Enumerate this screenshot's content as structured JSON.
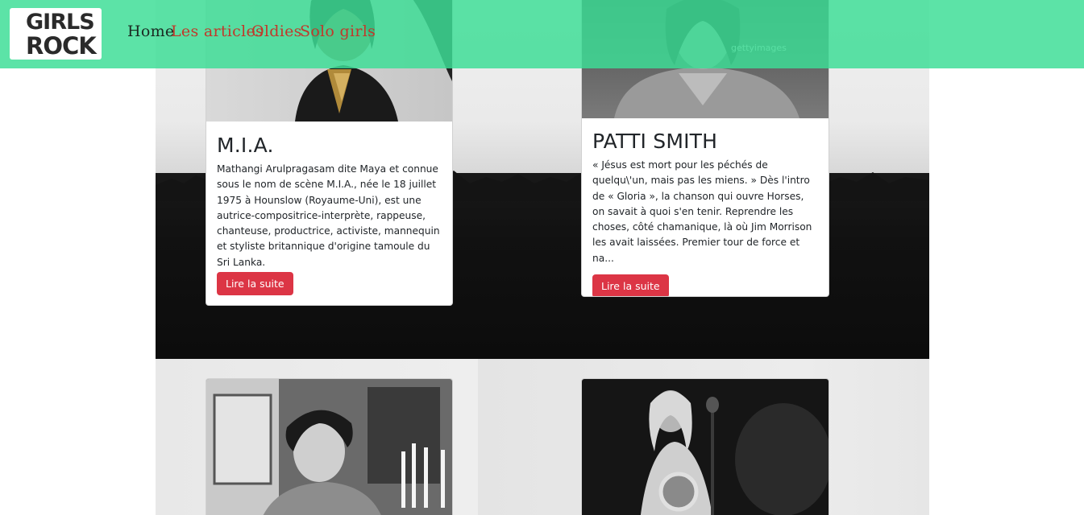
{
  "brand": {
    "logo_line1": "GIRLS",
    "logo_line2": "ROCK"
  },
  "nav": {
    "items": [
      {
        "label": "Home",
        "color": "#1b2a22"
      },
      {
        "label": "Les articles",
        "color": "#c0392b"
      },
      {
        "label": "Oldies",
        "color": "#c0392b"
      },
      {
        "label": "Solo girls",
        "color": "#c0392b"
      }
    ]
  },
  "cards": [
    {
      "title": "M.I.A.",
      "text": "Mathangi Arulpragasam dite Maya et connue sous le nom de scène M.I.A., née le 18 juillet 1975 à Hounslow (Royaume-Uni), est une autrice-compositrice-interprète, rappeuse, chanteuse, productrice, activiste, mannequin et styliste britannique d'origine tamoule du Sri Lanka.",
      "button": "Lire la suite"
    },
    {
      "title": "PATTI SMITH",
      "text": "« Jésus est mort pour les péchés de quelqu\\'un, mais pas les miens. » Dès l'intro de « Gloria », la chanson qui ouvre Horses, on savait à quoi s'en tenir. Reprendre les choses, côté chamanique, là où Jim Morrison les avait laissées. Premier tour de force et na...",
      "button": "Lire la suite",
      "watermark": "gettyimages"
    }
  ],
  "colors": {
    "navbar": "#3dde96",
    "button": "#dc3545"
  }
}
